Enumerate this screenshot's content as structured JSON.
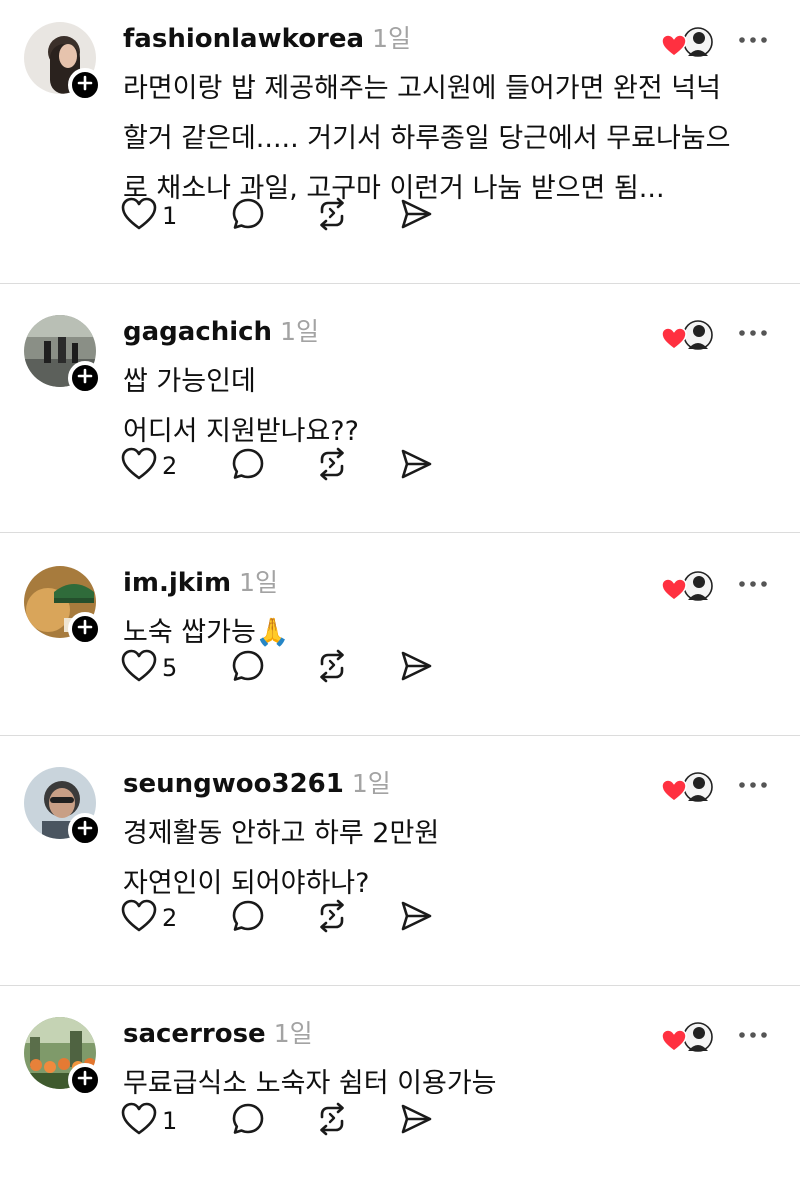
{
  "posts": [
    {
      "username": "fashionlawkorea",
      "time": "1일",
      "lines": [
        "라면이랑 밥 제공해주는 고시원에 들어가면 완전 넉넉",
        "할거 같은데..... 거기서 하루종일 당근에서 무료나눔으",
        "로 채소나 과일, 고구마 이런거 나눔 받으면 됨..."
      ],
      "likes": "1"
    },
    {
      "username": "gagachich",
      "time": "1일",
      "lines": [
        "쌉 가능인데",
        "어디서 지원받나요??"
      ],
      "likes": "2"
    },
    {
      "username": "im.jkim",
      "time": "1일",
      "lines": [
        "노숙 쌉가능🙏"
      ],
      "likes": "5"
    },
    {
      "username": "seungwoo3261",
      "time": "1일",
      "lines": [
        "경제활동 안하고 하루 2만원",
        "자연인이 되어야하나?"
      ],
      "likes": "2"
    },
    {
      "username": "sacerrose",
      "time": "1일",
      "lines": [
        "무료급식소 노숙자 쉼터 이용가능"
      ],
      "likes": "1"
    }
  ],
  "colors": {
    "heart_red": "#ff3040",
    "timestamp_gray": "#a3a3a3",
    "divider": "#dcdcdc"
  },
  "icons": {
    "like": "heart-outline-icon",
    "reply": "speech-bubble-icon",
    "repost": "repost-arrows-icon",
    "share": "send-icon",
    "more": "more-dots-icon",
    "follow": "plus-icon"
  }
}
